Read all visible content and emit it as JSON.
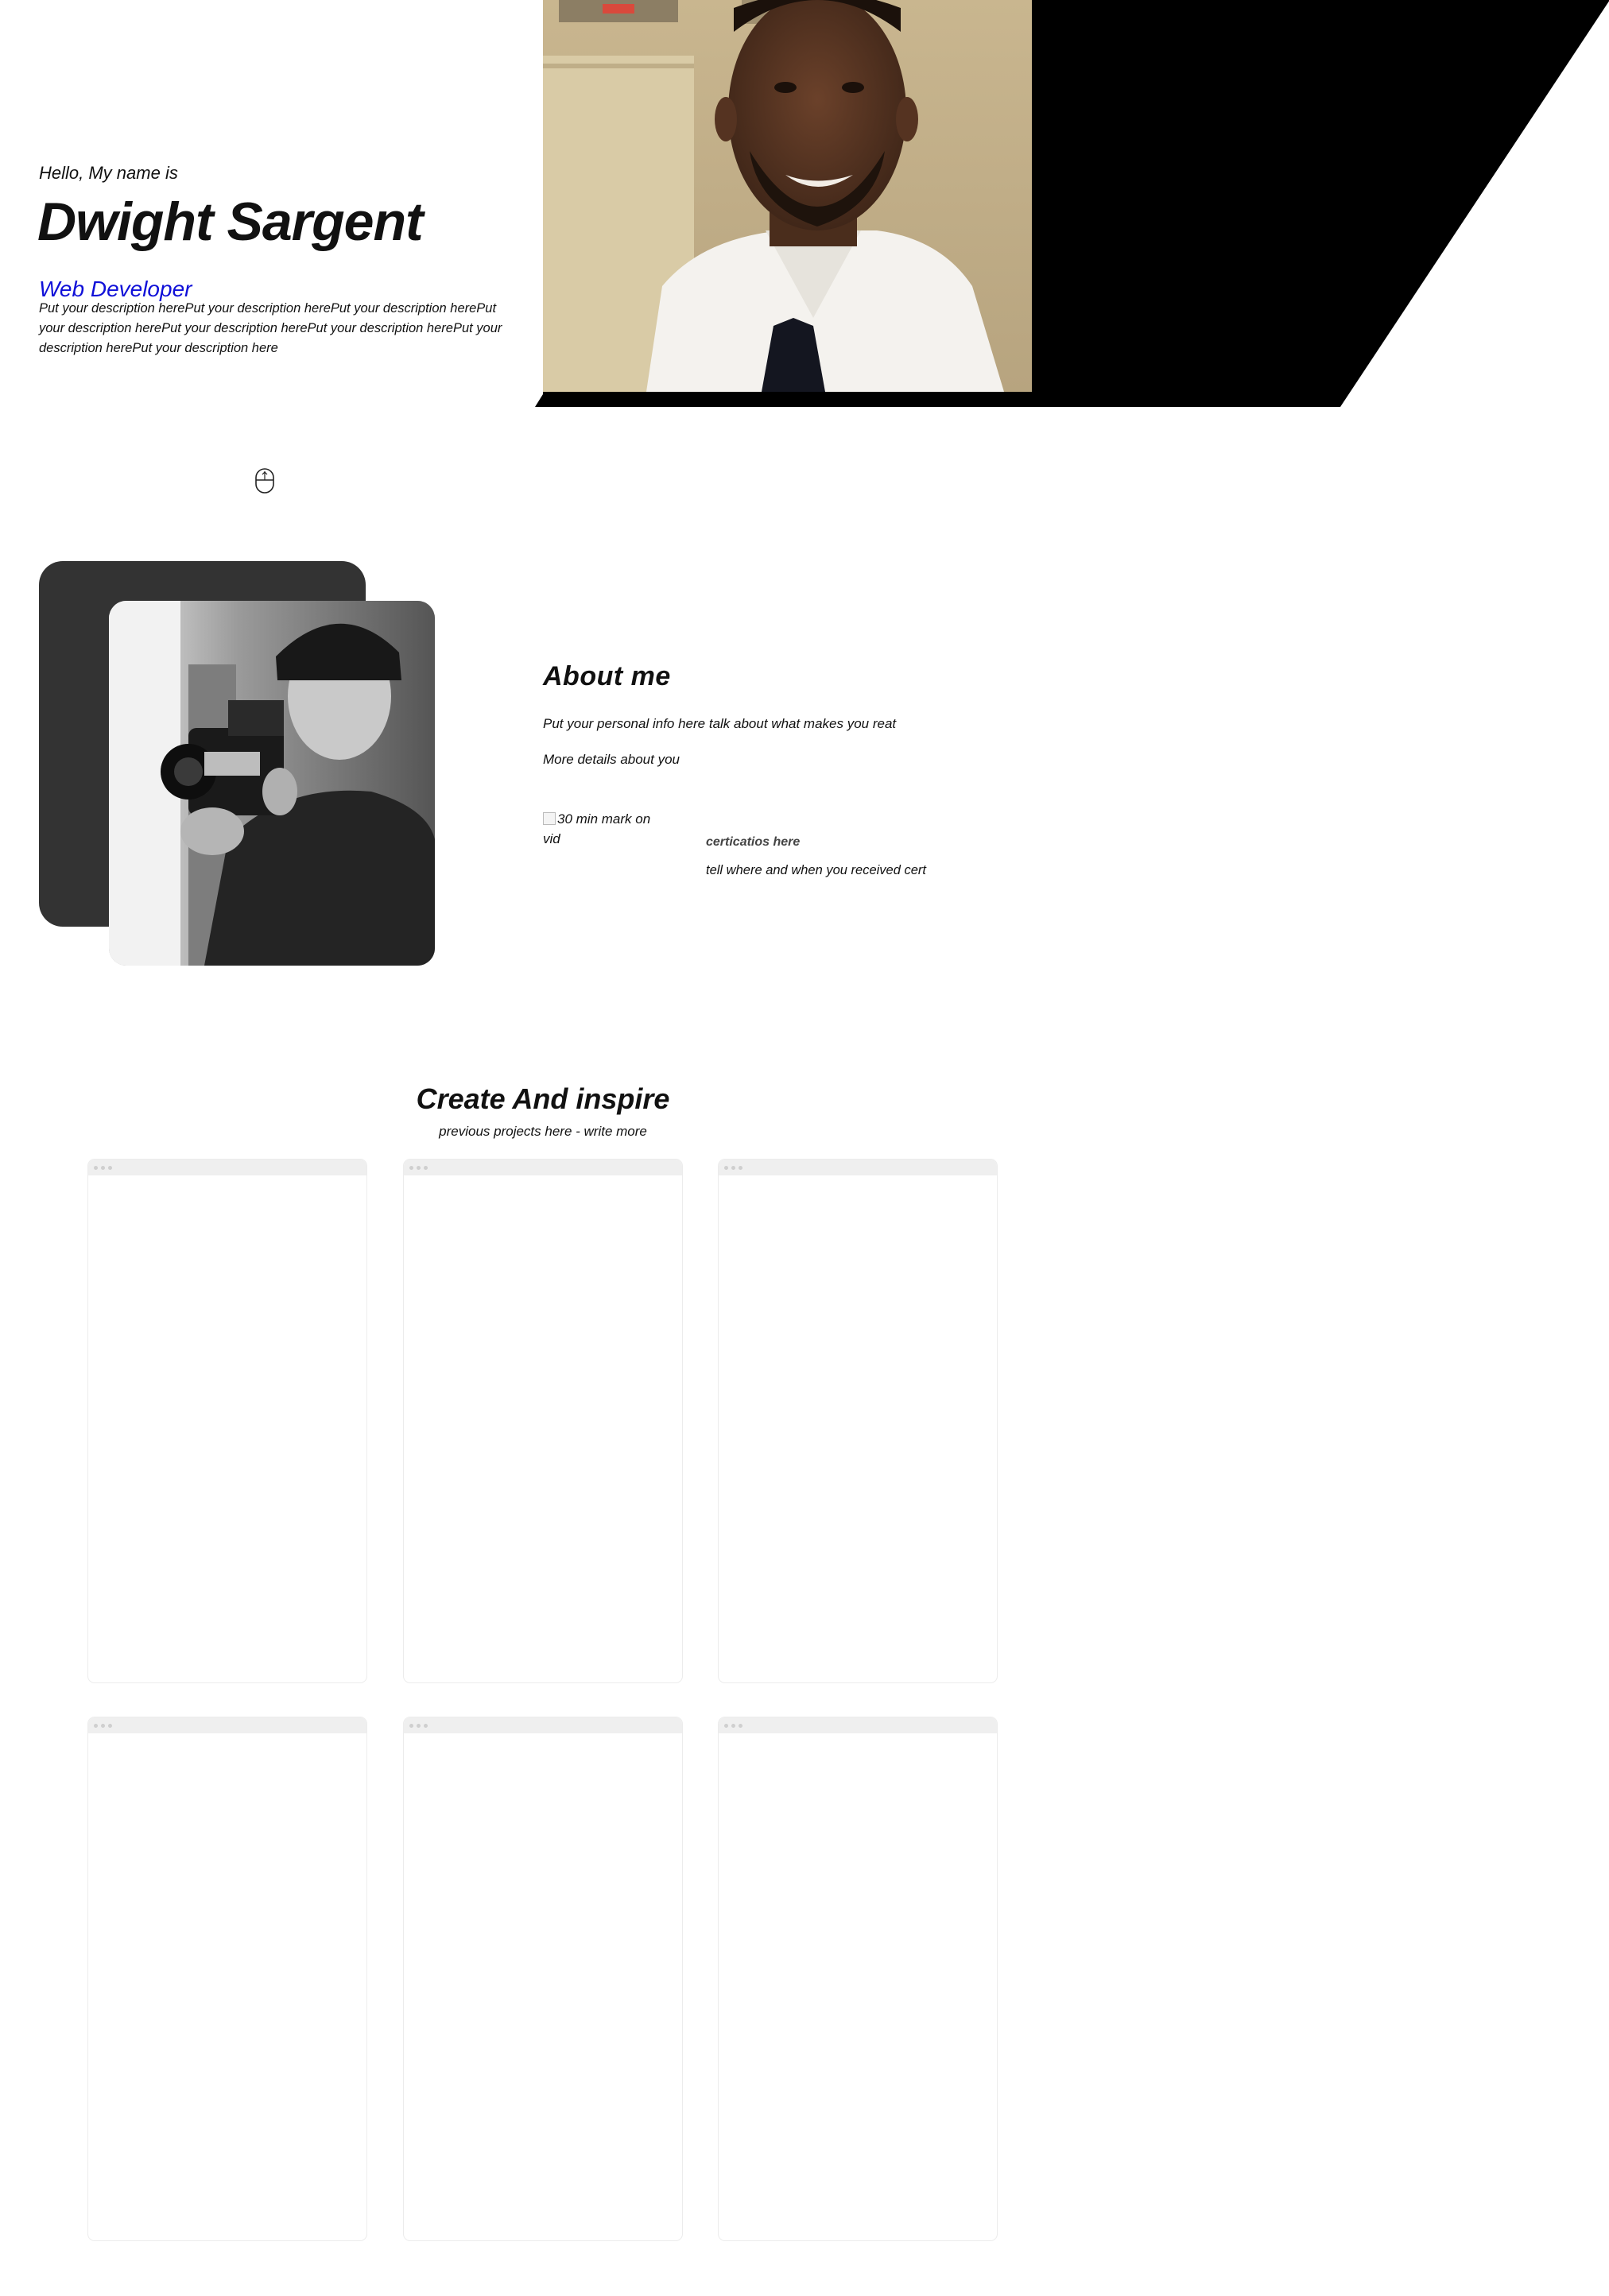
{
  "hero": {
    "greeting": "Hello, My name is",
    "name": "Dwight Sargent",
    "role": "Web Developer",
    "description": "Put your description herePut your description herePut your description herePut your description herePut your description herePut your description herePut your description herePut your description here"
  },
  "scroll_hint": {
    "icon": "mouse-scroll-icon"
  },
  "about": {
    "title": "About me",
    "info": "Put your personal info here talk about what makes you reat",
    "more": "More details about you",
    "image_alt": "30 min mark on vid",
    "cert_title": "certicatios here",
    "cert_desc": "tell where and when you received cert"
  },
  "projects": {
    "title": "Create And inspire",
    "subtitle": "previous projects here - write more",
    "cards": 6
  }
}
